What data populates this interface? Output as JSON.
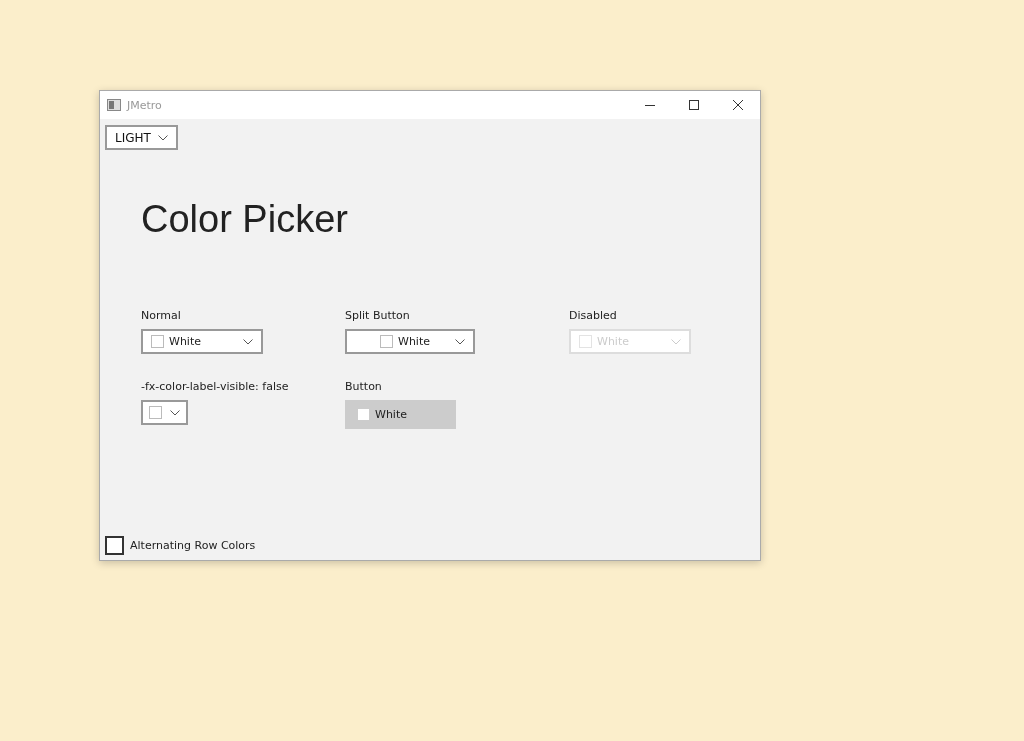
{
  "window": {
    "title": "JMetro"
  },
  "theme_combo": {
    "value": "LIGHT"
  },
  "heading": "Color Picker",
  "pickers": [
    {
      "label": "Normal",
      "kind": "combo",
      "value": "White",
      "color": "#ffffff",
      "disabled": false
    },
    {
      "label": "Split Button",
      "kind": "split",
      "value": "White",
      "color": "#ffffff",
      "disabled": false
    },
    {
      "label": "Disabled",
      "kind": "combo",
      "value": "White",
      "color": "#ffffff",
      "disabled": true
    },
    {
      "label": "-fx-color-label-visible: false",
      "kind": "icon-only",
      "color": "#ffffff",
      "disabled": false
    },
    {
      "label": "Button",
      "kind": "button",
      "value": "White",
      "color": "#ffffff",
      "disabled": false
    }
  ],
  "alternating_rows": {
    "label": "Alternating Row Colors",
    "checked": false
  }
}
